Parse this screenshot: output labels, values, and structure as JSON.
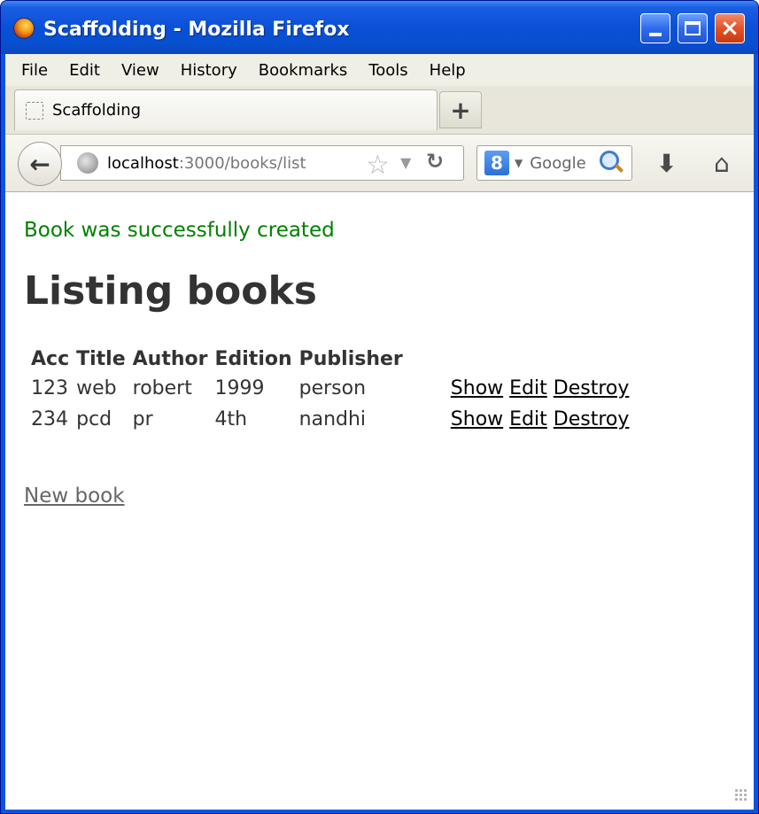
{
  "window": {
    "title": "Scaffolding - Mozilla Firefox"
  },
  "menu": {
    "items": [
      "File",
      "Edit",
      "View",
      "History",
      "Bookmarks",
      "Tools",
      "Help"
    ]
  },
  "tab": {
    "label": "Scaffolding",
    "new_tab_symbol": "+"
  },
  "navbar": {
    "url_host": "localhost",
    "url_path": ":3000/books/list",
    "search_placeholder": "Google",
    "search_engine_badge": "8"
  },
  "content": {
    "notice": "Book was successfully created",
    "title": "Listing books",
    "columns": [
      "Acc",
      "Title",
      "Author",
      "Edition",
      "Publisher"
    ],
    "rows": [
      {
        "acc": "123",
        "title": "web",
        "author": "robert",
        "edition": "1999",
        "publisher": "person"
      },
      {
        "acc": "234",
        "title": "pcd",
        "author": "pr",
        "edition": "4th",
        "publisher": "nandhi"
      }
    ],
    "actions": {
      "show": "Show",
      "edit": "Edit",
      "destroy": "Destroy"
    },
    "new_link": "New book"
  },
  "icons": {
    "app": "firefox-icon",
    "back": "back-arrow-icon",
    "site": "globe-icon",
    "bookmark": "star-icon",
    "reload": "reload-icon",
    "search": "magnifier-icon",
    "download": "download-icon",
    "home": "home-icon"
  },
  "colors": {
    "notice": "#008000",
    "title_bar": "#0a4fd8"
  }
}
